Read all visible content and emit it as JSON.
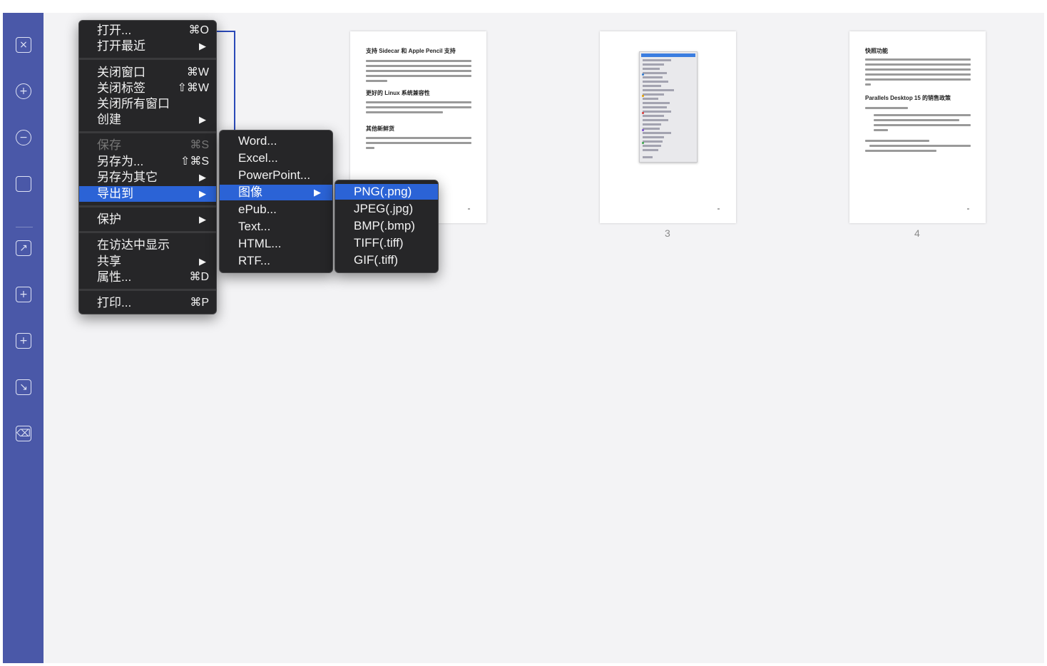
{
  "sidebar": {
    "icons": [
      "close-doc-icon",
      "zoom-in-icon",
      "zoom-out-icon",
      "page-icon",
      "extract-page-icon",
      "insert-page-icon",
      "insert-folder-icon",
      "replace-page-icon",
      "delete-page-icon"
    ]
  },
  "pages": [
    {
      "number": "",
      "headings": [
        "支持 Sidecar 和 Apple Pencil 支持",
        "更好的 Linux 系统兼容性",
        "其他新鲜货"
      ]
    },
    {
      "number": "3",
      "popup_first_item": "Send with Windows Email App"
    },
    {
      "number": "4",
      "headings": [
        "快照功能",
        "Parallels Desktop 15 的销售政策"
      ]
    }
  ],
  "file_menu": {
    "items": [
      {
        "label": "打开...",
        "shortcut": "⌘O"
      },
      {
        "label": "打开最近",
        "submenu": true
      },
      {
        "label": "关闭窗口",
        "shortcut": "⌘W"
      },
      {
        "label": "关闭标签",
        "shortcut": "⇧⌘W"
      },
      {
        "label": "关闭所有窗口"
      },
      {
        "label": "创建",
        "submenu": true
      },
      {
        "label": "保存",
        "shortcut": "⌘S",
        "disabled": true
      },
      {
        "label": "另存为...",
        "shortcut": "⇧⌘S"
      },
      {
        "label": "另存为其它",
        "submenu": true
      },
      {
        "label": "导出到",
        "submenu": true,
        "selected": true
      },
      {
        "label": "保护",
        "submenu": true
      },
      {
        "label": "在访达中显示"
      },
      {
        "label": "共享",
        "submenu": true
      },
      {
        "label": "属性...",
        "shortcut": "⌘D"
      },
      {
        "label": "打印...",
        "shortcut": "⌘P"
      }
    ]
  },
  "export_menu": {
    "items": [
      {
        "label": "Word..."
      },
      {
        "label": "Excel..."
      },
      {
        "label": "PowerPoint..."
      },
      {
        "label": "图像",
        "submenu": true,
        "selected": true
      },
      {
        "label": "ePub..."
      },
      {
        "label": "Text..."
      },
      {
        "label": "HTML..."
      },
      {
        "label": "RTF..."
      }
    ]
  },
  "image_menu": {
    "items": [
      {
        "label": "PNG(.png)",
        "selected": true
      },
      {
        "label": "JPEG(.jpg)"
      },
      {
        "label": "BMP(.bmp)"
      },
      {
        "label": "TIFF(.tiff)"
      },
      {
        "label": "GIF(.tiff)"
      }
    ]
  },
  "submenu_arrow": "▶",
  "colors": {
    "sidebar": "#4a58a8",
    "menu_bg": "#262628",
    "selection": "#2b63d6",
    "canvas": "#f3f3f5"
  }
}
